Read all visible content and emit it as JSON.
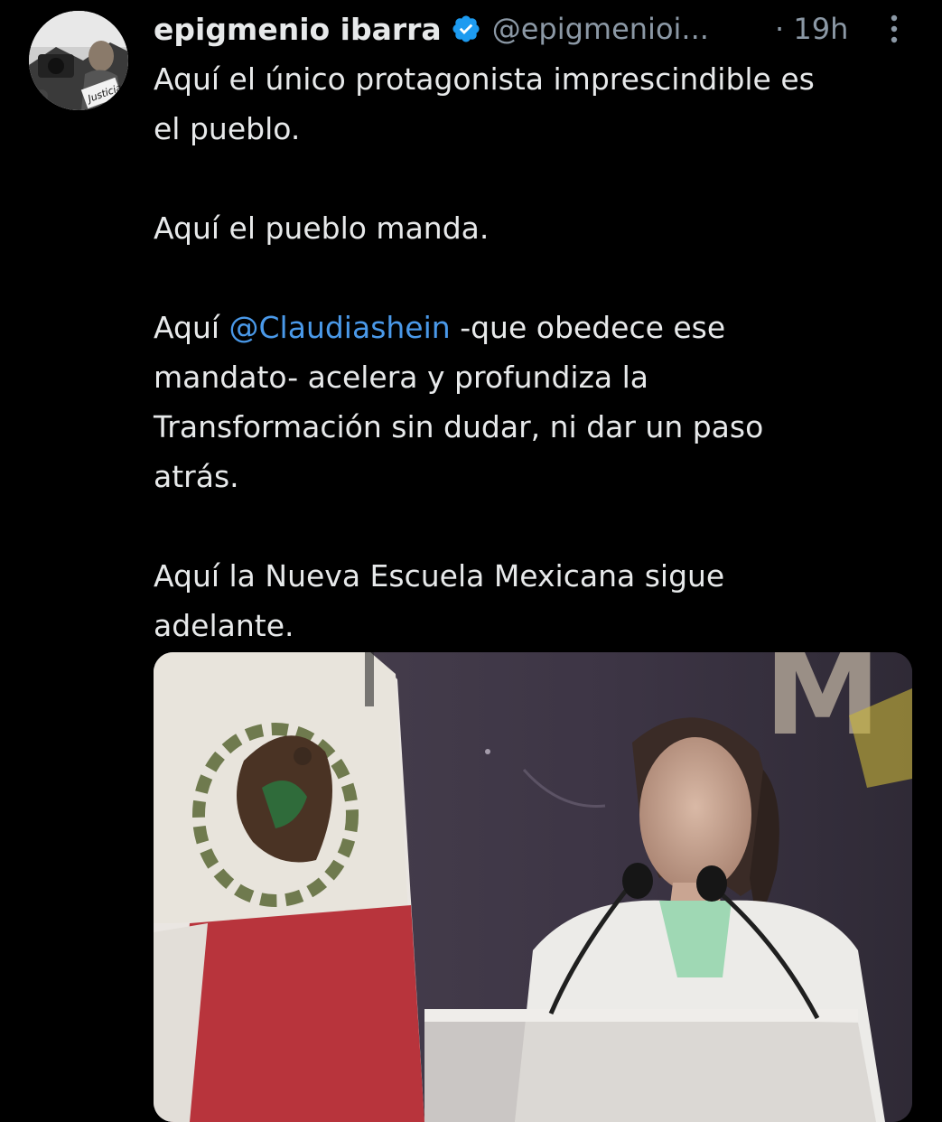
{
  "author": {
    "display_name": "epigmenio ibarra",
    "handle": "@epigmenioi...",
    "time": "· 19h",
    "avatar_sign_text": "Justicia"
  },
  "tweet": {
    "para1_lines": [
      "Aquí el único protagonista imprescindible es",
      "el pueblo."
    ],
    "para2": "Aquí el pueblo manda.",
    "para3_prefix": "Aquí ",
    "para3_mention": "@Claudiashein",
    "para3_rest_line1": " -que obedece ese",
    "para3_lines": [
      "mandato- acelera y profundiza la",
      "Transformación sin dudar, ni dar un paso",
      "atrás."
    ],
    "para4_lines": [
      "Aquí la Nueva Escuela Mexicana sigue",
      "adelante."
    ]
  },
  "media": {
    "backdrop_letters": "M"
  },
  "colors": {
    "background": "#000000",
    "text": "#e7e9ea",
    "secondary": "#8b98a5",
    "mention": "#4a99e9",
    "verified": "#1d9bf0"
  }
}
